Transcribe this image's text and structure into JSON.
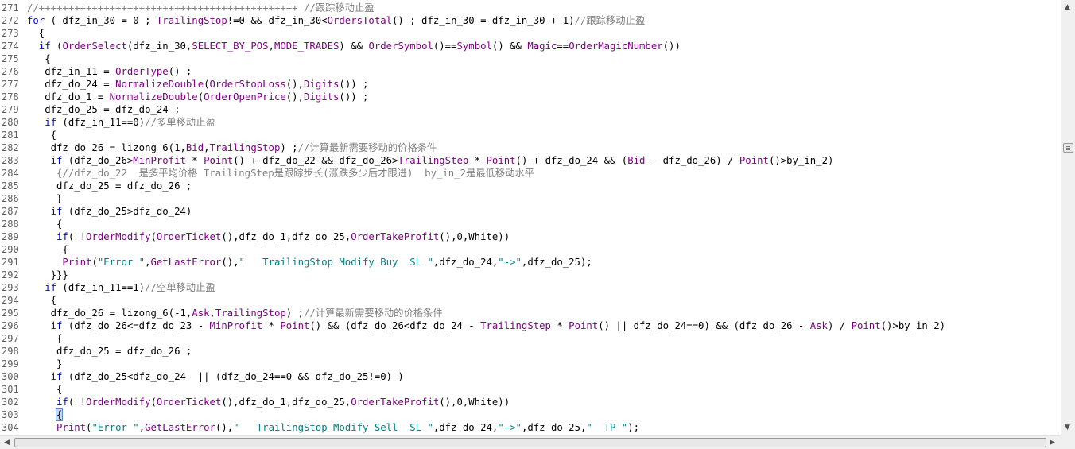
{
  "editor": {
    "lines": [
      {
        "n": "271",
        "t": [
          [
            "cm",
            "//++++++++++++++++++++++++++++++++++++++++++++ //跟踪移动止盈"
          ]
        ]
      },
      {
        "n": "272",
        "t": [
          [
            "kw",
            "for"
          ],
          [
            "op",
            " ( dfz_in_30 = 0 ; "
          ],
          [
            "fn",
            "TrailingStop"
          ],
          [
            "op",
            "!=0 && dfz_in_30<"
          ],
          [
            "fn",
            "OrdersTotal"
          ],
          [
            "op",
            "() ; dfz_in_30 = dfz_in_30 + 1)"
          ],
          [
            "cm",
            "//跟踪移动止盈"
          ]
        ]
      },
      {
        "n": "273",
        "t": [
          [
            "op",
            "  {"
          ]
        ]
      },
      {
        "n": "274",
        "t": [
          [
            "kw",
            "  if"
          ],
          [
            "op",
            " ("
          ],
          [
            "fn",
            "OrderSelect"
          ],
          [
            "op",
            "(dfz_in_30,"
          ],
          [
            "fn",
            "SELECT_BY_POS"
          ],
          [
            "op",
            ","
          ],
          [
            "fn",
            "MODE_TRADES"
          ],
          [
            "op",
            ") && "
          ],
          [
            "fn",
            "OrderSymbol"
          ],
          [
            "op",
            "()=="
          ],
          [
            "fn",
            "Symbol"
          ],
          [
            "op",
            "() && "
          ],
          [
            "fn",
            "Magic"
          ],
          [
            "op",
            "=="
          ],
          [
            "fn",
            "OrderMagicNumber"
          ],
          [
            "op",
            "())"
          ]
        ]
      },
      {
        "n": "275",
        "t": [
          [
            "op",
            "   {"
          ]
        ]
      },
      {
        "n": "276",
        "t": [
          [
            "op",
            "   dfz_in_11 = "
          ],
          [
            "fn",
            "OrderType"
          ],
          [
            "op",
            "() ;"
          ]
        ]
      },
      {
        "n": "277",
        "t": [
          [
            "op",
            "   dfz_do_24 = "
          ],
          [
            "fn",
            "NormalizeDouble"
          ],
          [
            "op",
            "("
          ],
          [
            "fn",
            "OrderStopLoss"
          ],
          [
            "op",
            "(),"
          ],
          [
            "fn",
            "Digits"
          ],
          [
            "op",
            "()) ;"
          ]
        ]
      },
      {
        "n": "278",
        "t": [
          [
            "op",
            "   dfz_do_1 = "
          ],
          [
            "fn",
            "NormalizeDouble"
          ],
          [
            "op",
            "("
          ],
          [
            "fn",
            "OrderOpenPrice"
          ],
          [
            "op",
            "(),"
          ],
          [
            "fn",
            "Digits"
          ],
          [
            "op",
            "()) ;"
          ]
        ]
      },
      {
        "n": "279",
        "t": [
          [
            "op",
            "   dfz_do_25 = dfz_do_24 ;"
          ]
        ]
      },
      {
        "n": "280",
        "t": [
          [
            "kw",
            "   if"
          ],
          [
            "op",
            " (dfz_in_11==0)"
          ],
          [
            "cm",
            "//多单移动止盈"
          ]
        ]
      },
      {
        "n": "281",
        "t": [
          [
            "op",
            "    {"
          ]
        ]
      },
      {
        "n": "282",
        "t": [
          [
            "op",
            "    dfz_do_26 = lizong_6(1,"
          ],
          [
            "fn",
            "Bid"
          ],
          [
            "op",
            ","
          ],
          [
            "fn",
            "TrailingStop"
          ],
          [
            "op",
            ") ;"
          ],
          [
            "cm",
            "//计算最新需要移动的价格条件"
          ]
        ]
      },
      {
        "n": "283",
        "t": [
          [
            "kw",
            "    if"
          ],
          [
            "op",
            " (dfz_do_26>"
          ],
          [
            "fn",
            "MinProfit"
          ],
          [
            "op",
            " * "
          ],
          [
            "fn",
            "Point"
          ],
          [
            "op",
            "() + dfz_do_22 && dfz_do_26>"
          ],
          [
            "fn",
            "TrailingStep"
          ],
          [
            "op",
            " * "
          ],
          [
            "fn",
            "Point"
          ],
          [
            "op",
            "() + dfz_do_24 && ("
          ],
          [
            "fn",
            "Bid"
          ],
          [
            "op",
            " - dfz_do_26) / "
          ],
          [
            "fn",
            "Point"
          ],
          [
            "op",
            "()>by_in_2)"
          ]
        ]
      },
      {
        "n": "284",
        "t": [
          [
            "cm",
            "     {//dfz_do_22  是多平均价格 TrailingStep是跟踪步长(涨跌多少后才跟进)  by_in_2是最低移动水平"
          ]
        ]
      },
      {
        "n": "285",
        "t": [
          [
            "op",
            "     dfz_do_25 = dfz_do_26 ;"
          ]
        ]
      },
      {
        "n": "286",
        "t": [
          [
            "op",
            "     }"
          ]
        ]
      },
      {
        "n": "287",
        "t": [
          [
            "kw",
            "    if"
          ],
          [
            "op",
            " (dfz_do_25>dfz_do_24)"
          ]
        ]
      },
      {
        "n": "288",
        "t": [
          [
            "op",
            "     {"
          ]
        ]
      },
      {
        "n": "289",
        "t": [
          [
            "kw",
            "     if"
          ],
          [
            "op",
            "( !"
          ],
          [
            "fn",
            "OrderModify"
          ],
          [
            "op",
            "("
          ],
          [
            "fn",
            "OrderTicket"
          ],
          [
            "op",
            "(),dfz_do_1,dfz_do_25,"
          ],
          [
            "fn",
            "OrderTakeProfit"
          ],
          [
            "op",
            "(),0,White))"
          ]
        ]
      },
      {
        "n": "290",
        "t": [
          [
            "op",
            "      {"
          ]
        ]
      },
      {
        "n": "291",
        "t": [
          [
            "fn",
            "      Print"
          ],
          [
            "op",
            "("
          ],
          [
            "st",
            "\"Error \""
          ],
          [
            "op",
            ","
          ],
          [
            "fn",
            "GetLastError"
          ],
          [
            "op",
            "(),"
          ],
          [
            "st",
            "\"   TrailingStop Modify Buy  SL \""
          ],
          [
            "op",
            ",dfz_do_24,"
          ],
          [
            "st",
            "\"->\""
          ],
          [
            "op",
            ",dfz_do_25);"
          ]
        ]
      },
      {
        "n": "292",
        "t": [
          [
            "op",
            "    }}}"
          ]
        ]
      },
      {
        "n": "293",
        "t": [
          [
            "kw",
            "   if"
          ],
          [
            "op",
            " (dfz_in_11==1)"
          ],
          [
            "cm",
            "//空单移动止盈"
          ]
        ]
      },
      {
        "n": "294",
        "t": [
          [
            "op",
            "    {"
          ]
        ]
      },
      {
        "n": "295",
        "t": [
          [
            "op",
            "    dfz_do_26 = lizong_6(-1,"
          ],
          [
            "fn",
            "Ask"
          ],
          [
            "op",
            ","
          ],
          [
            "fn",
            "TrailingStop"
          ],
          [
            "op",
            ") ;"
          ],
          [
            "cm",
            "//计算最新需要移动的价格条件"
          ]
        ]
      },
      {
        "n": "296",
        "t": [
          [
            "kw",
            "    if"
          ],
          [
            "op",
            " (dfz_do_26<=dfz_do_23 - "
          ],
          [
            "fn",
            "MinProfit"
          ],
          [
            "op",
            " * "
          ],
          [
            "fn",
            "Point"
          ],
          [
            "op",
            "() && (dfz_do_26<dfz_do_24 - "
          ],
          [
            "fn",
            "TrailingStep"
          ],
          [
            "op",
            " * "
          ],
          [
            "fn",
            "Point"
          ],
          [
            "op",
            "() || dfz_do_24==0) && (dfz_do_26 - "
          ],
          [
            "fn",
            "Ask"
          ],
          [
            "op",
            ") / "
          ],
          [
            "fn",
            "Point"
          ],
          [
            "op",
            "()>by_in_2)"
          ]
        ]
      },
      {
        "n": "297",
        "t": [
          [
            "op",
            "     {"
          ]
        ]
      },
      {
        "n": "298",
        "t": [
          [
            "op",
            "     dfz_do_25 = dfz_do_26 ;"
          ]
        ]
      },
      {
        "n": "299",
        "t": [
          [
            "op",
            "     }"
          ]
        ]
      },
      {
        "n": "300",
        "t": [
          [
            "kw",
            "    if"
          ],
          [
            "op",
            " (dfz_do_25<dfz_do_24  || (dfz_do_24==0 && dfz_do_25!=0) )"
          ]
        ]
      },
      {
        "n": "301",
        "t": [
          [
            "op",
            "     {"
          ]
        ]
      },
      {
        "n": "302",
        "t": [
          [
            "kw",
            "     if"
          ],
          [
            "op",
            "( !"
          ],
          [
            "fn",
            "OrderModify"
          ],
          [
            "op",
            "("
          ],
          [
            "fn",
            "OrderTicket"
          ],
          [
            "op",
            "(),dfz_do_1,dfz_do_25,"
          ],
          [
            "fn",
            "OrderTakeProfit"
          ],
          [
            "op",
            "(),0,White))"
          ]
        ]
      },
      {
        "n": "303",
        "t": [
          [
            "op",
            "     "
          ],
          [
            "brace",
            "{"
          ]
        ]
      },
      {
        "n": "304",
        "t": [
          [
            "fn",
            "     Print"
          ],
          [
            "op",
            "("
          ],
          [
            "st",
            "\"Error \""
          ],
          [
            "op",
            ","
          ],
          [
            "fn",
            "GetLastError"
          ],
          [
            "op",
            "(),"
          ],
          [
            "st",
            "\"   TrailingStop Modify Sell  SL \""
          ],
          [
            "op",
            ",dfz do 24,"
          ],
          [
            "st",
            "\"->\""
          ],
          [
            "op",
            ",dfz do 25,"
          ],
          [
            "st",
            "\"  TP \""
          ],
          [
            "op",
            ");"
          ]
        ]
      }
    ]
  },
  "scrollbars": {
    "up_arrow": "▲",
    "down_arrow": "▼",
    "left_arrow": "◀",
    "right_arrow": "▶"
  },
  "colors": {
    "keyword": "#0000ff",
    "function": "#7f0085",
    "comment": "#808080",
    "string": "#008080"
  }
}
